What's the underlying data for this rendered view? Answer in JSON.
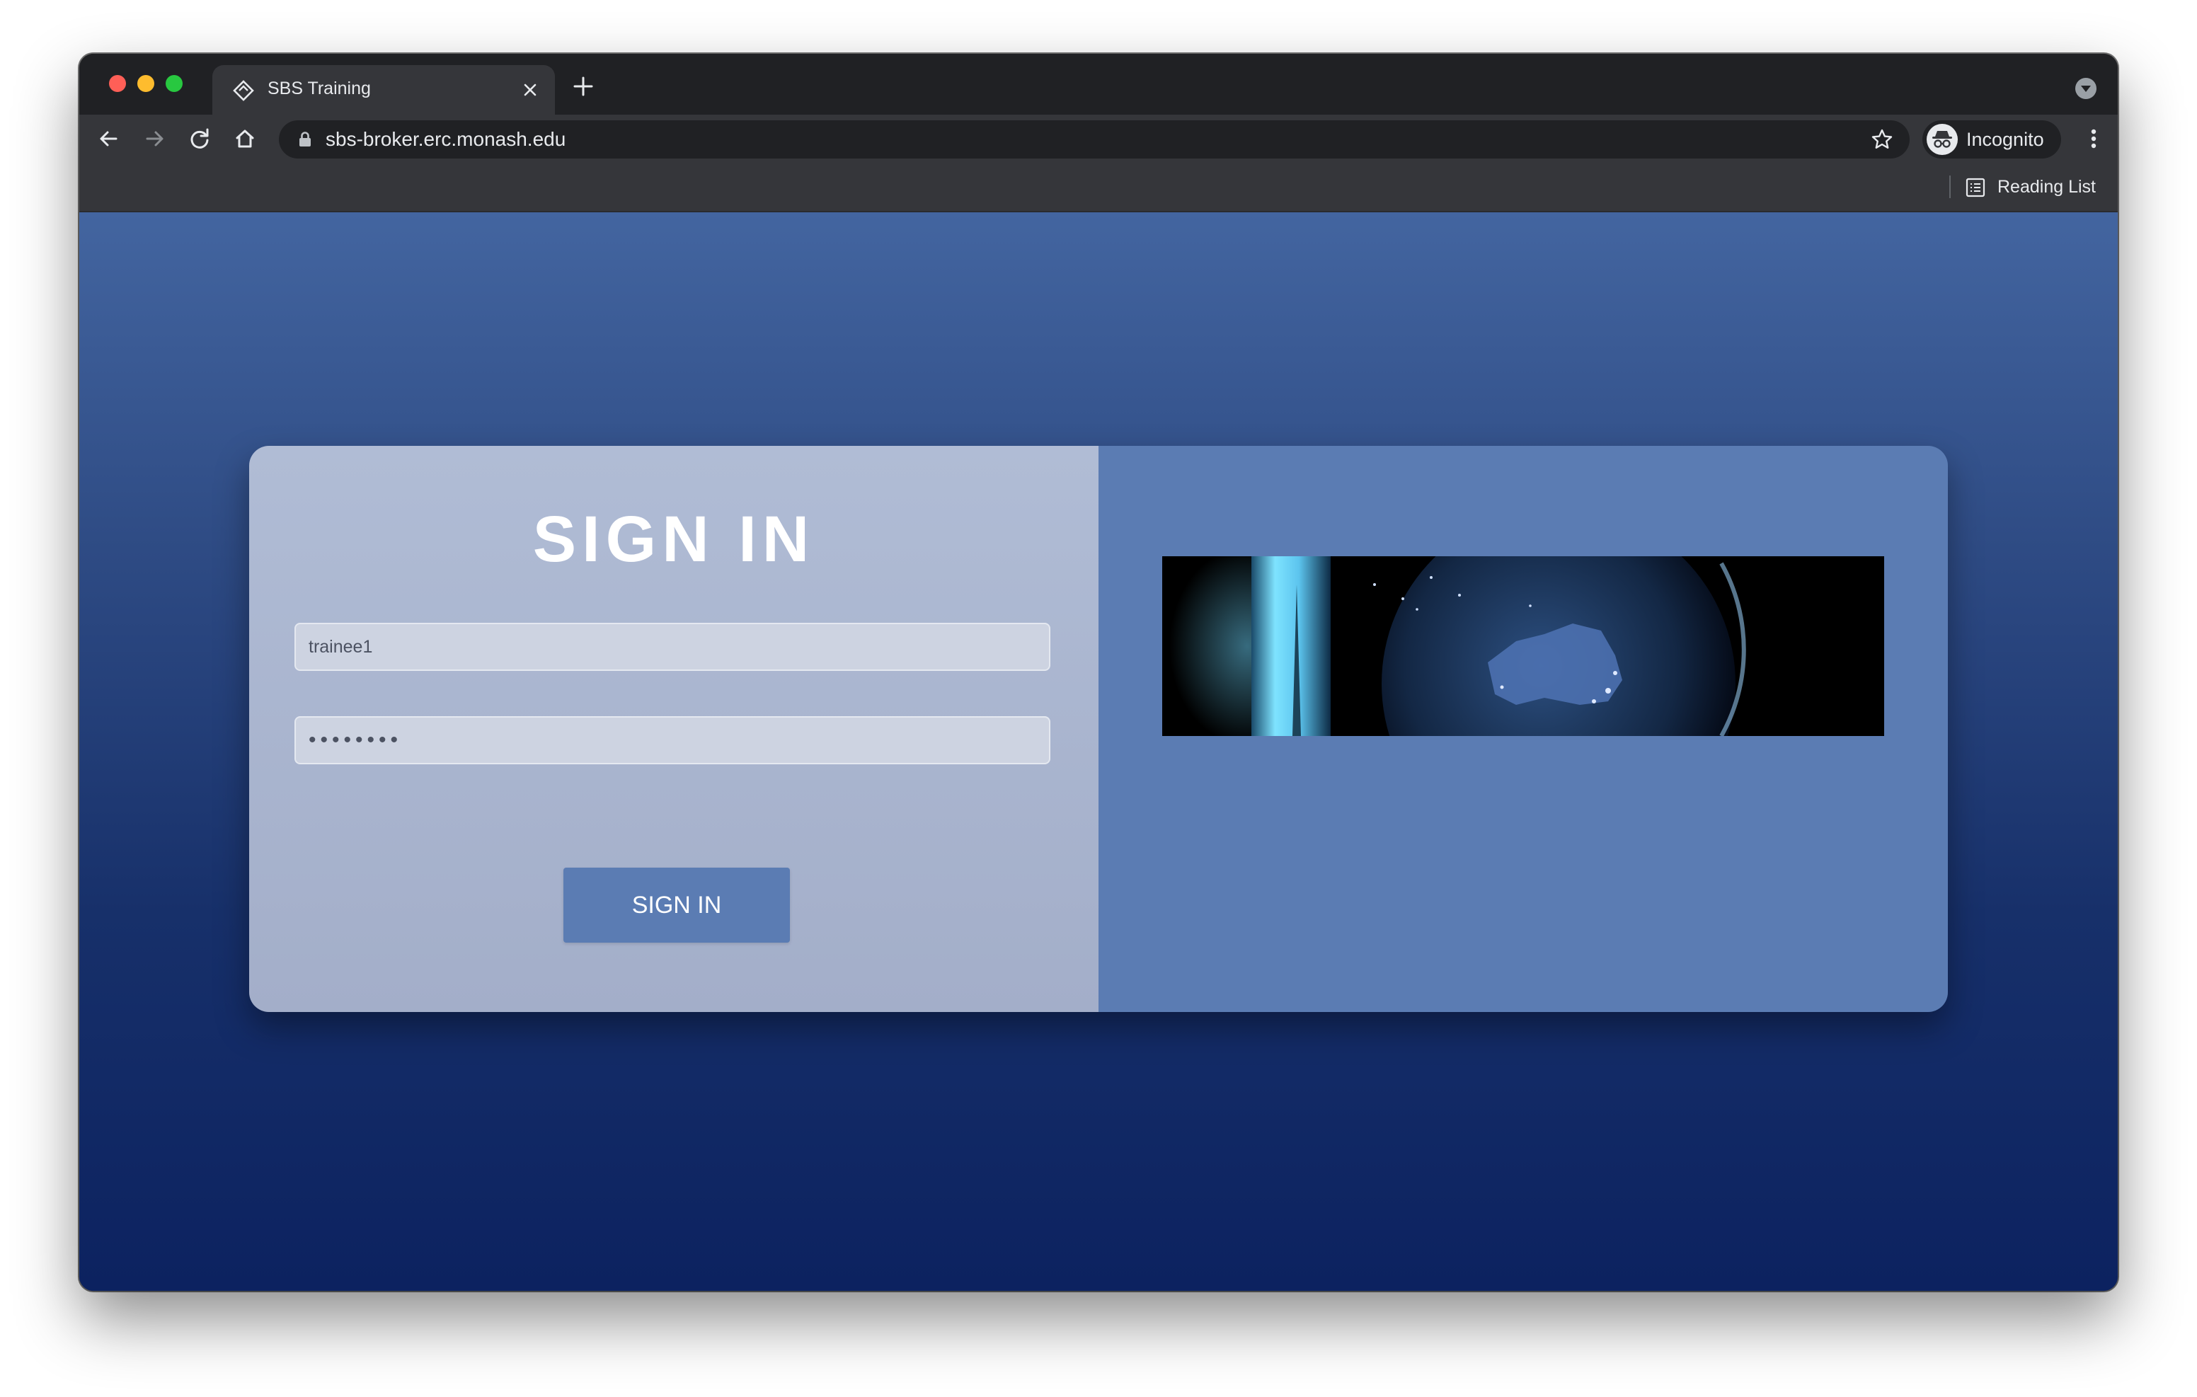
{
  "browser": {
    "tab": {
      "title": "SBS Training"
    },
    "url": "sbs-broker.erc.monash.edu",
    "profile_label": "Incognito",
    "reading_list_label": "Reading List"
  },
  "login": {
    "heading": "SIGN IN",
    "username_value": "trainee1",
    "password_value": "••••••••",
    "submit_label": "SIGN IN"
  },
  "icons": {
    "tab_favicon": "diamond-logo-icon",
    "close": "close-icon",
    "new_tab": "plus-icon",
    "back": "arrow-left-icon",
    "forward": "arrow-right-icon",
    "reload": "reload-icon",
    "home": "home-icon",
    "lock": "lock-icon",
    "bookmark": "star-icon",
    "incognito": "incognito-icon",
    "menu": "kebab-menu-icon",
    "reading_list": "reading-list-icon"
  },
  "colors": {
    "page_top": "#4365a0",
    "page_bottom": "#0c2260",
    "card_left": "#a9b4cf",
    "card_right": "#5b7cb3",
    "button": "#5b7cb3"
  }
}
